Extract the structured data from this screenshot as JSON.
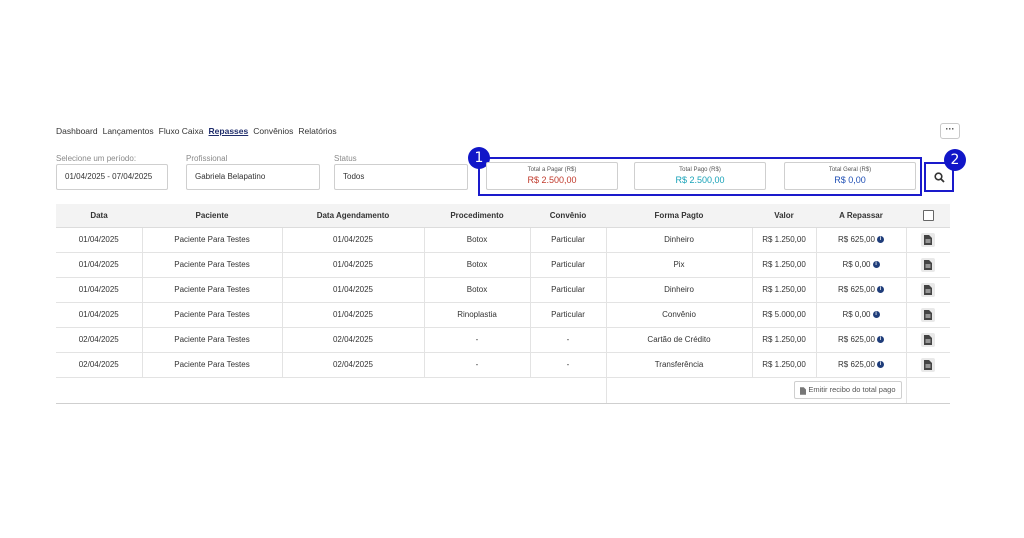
{
  "nav": [
    {
      "label": "Dashboard",
      "active": false
    },
    {
      "label": "Lançamentos",
      "active": false
    },
    {
      "label": "Fluxo Caixa",
      "active": false
    },
    {
      "label": "Repasses",
      "active": true
    },
    {
      "label": "Convênios",
      "active": false
    },
    {
      "label": "Relatórios",
      "active": false
    }
  ],
  "more_label": "···",
  "filters": {
    "period_label": "Selecione um período:",
    "period_value": "01/04/2025 - 07/04/2025",
    "professional_label": "Profissional",
    "professional_value": "Gabriela Belapatino",
    "status_label": "Status",
    "status_value": "Todos"
  },
  "badges": {
    "one": "1",
    "two": "2"
  },
  "totals": [
    {
      "label": "Total a Pagar (R$)",
      "value": "R$ 2.500,00",
      "color": "#c0392b"
    },
    {
      "label": "Total Pago (R$)",
      "value": "R$ 2.500,00",
      "color": "#17a2b8"
    },
    {
      "label": "Total Geral (R$)",
      "value": "R$ 0,00",
      "color": "#1f4fb5"
    }
  ],
  "table": {
    "headers": [
      "Data",
      "Paciente",
      "Data Agendamento",
      "Procedimento",
      "Convênio",
      "Forma Pagto",
      "Valor",
      "A Repassar"
    ],
    "rows": [
      [
        "01/04/2025",
        "Paciente Para Testes",
        "01/04/2025",
        "Botox",
        "Particular",
        "Dinheiro",
        "R$ 1.250,00",
        "R$ 625,00"
      ],
      [
        "01/04/2025",
        "Paciente Para Testes",
        "01/04/2025",
        "Botox",
        "Particular",
        "Pix",
        "R$ 1.250,00",
        "R$ 0,00"
      ],
      [
        "01/04/2025",
        "Paciente Para Testes",
        "01/04/2025",
        "Botox",
        "Particular",
        "Dinheiro",
        "R$ 1.250,00",
        "R$ 625,00"
      ],
      [
        "01/04/2025",
        "Paciente Para Testes",
        "01/04/2025",
        "Rinoplastia",
        "Particular",
        "Convênio",
        "R$ 5.000,00",
        "R$ 0,00"
      ],
      [
        "02/04/2025",
        "Paciente Para Testes",
        "02/04/2025",
        "-",
        "-",
        "Cartão de Crédito",
        "R$ 1.250,00",
        "R$ 625,00"
      ],
      [
        "02/04/2025",
        "Paciente Para Testes",
        "02/04/2025",
        "-",
        "-",
        "Transferência",
        "R$ 1.250,00",
        "R$ 625,00"
      ]
    ],
    "info_glyph": "i",
    "emit_label": "Emitir recibo do total pago"
  },
  "icons": {
    "search": "search-icon",
    "document": "document-icon",
    "info": "info-icon"
  }
}
